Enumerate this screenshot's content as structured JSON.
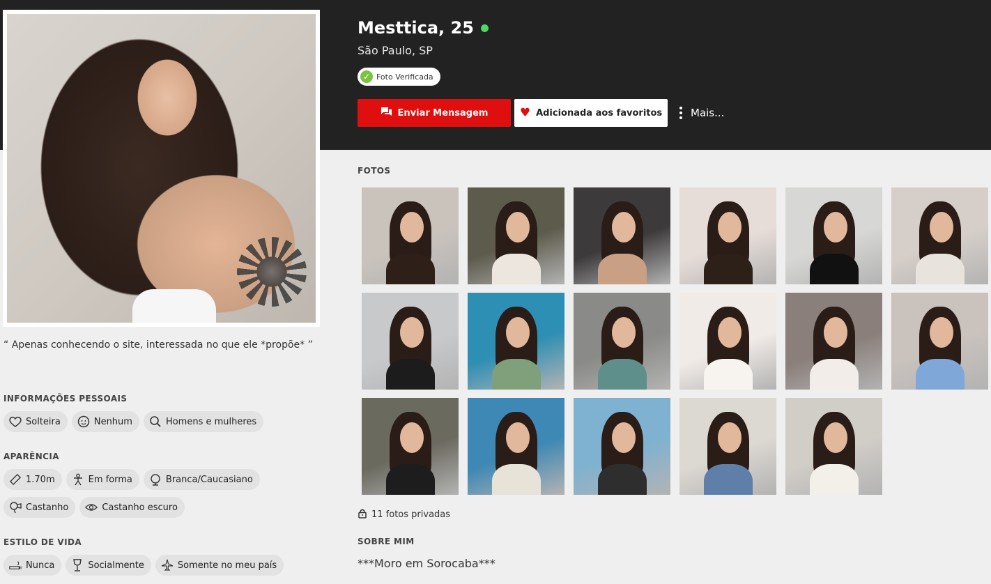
{
  "profile": {
    "name_age": "Mesttica, 25",
    "city": "São Paulo, SP",
    "verified_label": "Foto Verificada",
    "quote": "“ Apenas conhecendo o site, interessada no que ele *propõe* ”"
  },
  "actions": {
    "message_label": "Enviar Mensagem",
    "favorite_label": "Adicionada aos favoritos",
    "more_label": "Mais..."
  },
  "colors": {
    "header_bg": "#222222",
    "accent_red": "#e00f0f",
    "online_green": "#4cd964",
    "verified_green": "#7cc242"
  },
  "personal": {
    "title": "INFORMAÇÕES PESSOAIS",
    "chips": [
      {
        "icon": "heart-outline-icon",
        "label": "Solteira"
      },
      {
        "icon": "baby-face-icon",
        "label": "Nenhum"
      },
      {
        "icon": "search-icon",
        "label": "Homens e mulheres"
      }
    ]
  },
  "appearance": {
    "title": "APARÊNCIA",
    "chips": [
      {
        "icon": "ruler-icon",
        "label": "1.70m"
      },
      {
        "icon": "body-icon",
        "label": "Em forma"
      },
      {
        "icon": "globe-icon",
        "label": "Branca/Caucasiano"
      },
      {
        "icon": "hair-dryer-icon",
        "label": "Castanho"
      },
      {
        "icon": "eye-icon",
        "label": "Castanho escuro"
      }
    ]
  },
  "lifestyle": {
    "title": "ESTILO DE VIDA",
    "chips": [
      {
        "icon": "smoking-icon",
        "label": "Nunca"
      },
      {
        "icon": "wine-glass-icon",
        "label": "Socialmente"
      },
      {
        "icon": "airplane-icon",
        "label": "Somente no meu país"
      }
    ]
  },
  "photos": {
    "title": "FOTOS",
    "private_label": "11 fotos privadas",
    "items": [
      {
        "bg": "#c9c3bc",
        "accent": "#2e2019"
      },
      {
        "bg": "#5d5b4c",
        "accent": "#ece6de"
      },
      {
        "bg": "#3d3a3c",
        "accent": "#caa085"
      },
      {
        "bg": "#e7ddd8",
        "accent": "#2d2018"
      },
      {
        "bg": "#d7d7d5",
        "accent": "#111111"
      },
      {
        "bg": "#d6cfc9",
        "accent": "#e9e3dd"
      },
      {
        "bg": "#c8c9cb",
        "accent": "#1c1c1c"
      },
      {
        "bg": "#2e8fb4",
        "accent": "#7fa07a"
      },
      {
        "bg": "#8a8a88",
        "accent": "#5f8f8a"
      },
      {
        "bg": "#f1ebe7",
        "accent": "#f7f4f0"
      },
      {
        "bg": "#8a7f7a",
        "accent": "#f2ede8"
      },
      {
        "bg": "#c9c2bd",
        "accent": "#7fa7d8"
      },
      {
        "bg": "#6b6a5f",
        "accent": "#1d1d1d"
      },
      {
        "bg": "#3d88b4",
        "accent": "#e8e3d9"
      },
      {
        "bg": "#7fb2d0",
        "accent": "#2e2e2e"
      },
      {
        "bg": "#dcd8d2",
        "accent": "#5d7fa8"
      },
      {
        "bg": "#d1cdc7",
        "accent": "#f3efe9"
      }
    ]
  },
  "about": {
    "title": "SOBRE MIM",
    "text": "***Moro em Sorocaba***"
  }
}
